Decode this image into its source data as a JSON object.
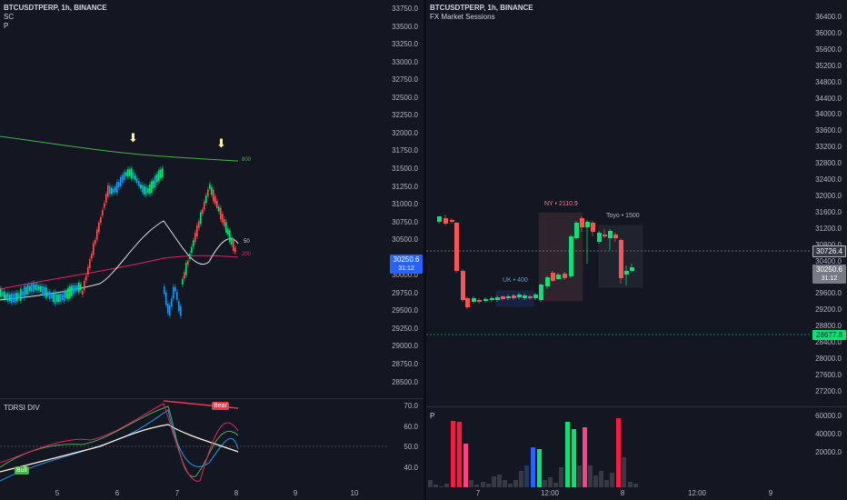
{
  "left": {
    "title": "BTCUSDTPERP, 1h, BINANCE",
    "sub1": "SC",
    "sub2": "P",
    "price_badge": "30250.6",
    "price_badge_time": "31:12",
    "ma_labels": {
      "ma800": "800",
      "ma50": "50",
      "ma200": "200"
    },
    "y_ticks": [
      "33750.0",
      "33500.0",
      "33250.0",
      "33000.0",
      "32750.0",
      "32500.0",
      "32250.0",
      "32000.0",
      "31750.0",
      "31500.0",
      "31250.0",
      "31000.0",
      "30750.0",
      "30500.0",
      "30250.0",
      "30000.0",
      "29750.0",
      "29500.0",
      "29250.0",
      "29000.0",
      "28750.0",
      "28500.0"
    ],
    "indicator_title": "TDRSI DIV",
    "indicator_ticks": [
      "70.0",
      "60.0",
      "50.0",
      "40.0"
    ],
    "bear_tag": "Bear",
    "bull_tag": "Bull",
    "x_ticks": [
      "5",
      "6",
      "7",
      "8",
      "9",
      "10"
    ]
  },
  "right": {
    "title": "BTCUSDTPERP, 1h, BINANCE",
    "subtitle": "FX Market Sessions",
    "sessions": [
      {
        "label": "UK • 400",
        "color": "#5b9bd5"
      },
      {
        "label": "NY • 2110.9",
        "color": "#f77c80"
      },
      {
        "label": "Toyo • 1500",
        "color": "#b2b5be"
      }
    ],
    "y_ticks": [
      "36400.0",
      "36000.0",
      "35600.0",
      "35200.0",
      "34800.0",
      "34400.0",
      "34000.0",
      "33600.0",
      "33200.0",
      "32800.0",
      "32400.0",
      "32000.0",
      "31600.0",
      "31200.0",
      "30800.0",
      "30400.0",
      "30000.0",
      "29600.0",
      "29200.0",
      "28800.0",
      "28400.0",
      "28000.0",
      "27600.0",
      "27200.0"
    ],
    "badge_high": "30726.4",
    "badge_price": "30250.6",
    "badge_time": "31:12",
    "badge_low": "28677.8",
    "volume_title": "P",
    "volume_ticks": [
      "60000.0",
      "40000.0",
      "20000.0"
    ],
    "x_ticks": [
      "7",
      "12:00",
      "8",
      "12:00",
      "9"
    ]
  },
  "colors": {
    "up": "#00e676",
    "down": "#ff5252",
    "bg": "#131722"
  }
}
